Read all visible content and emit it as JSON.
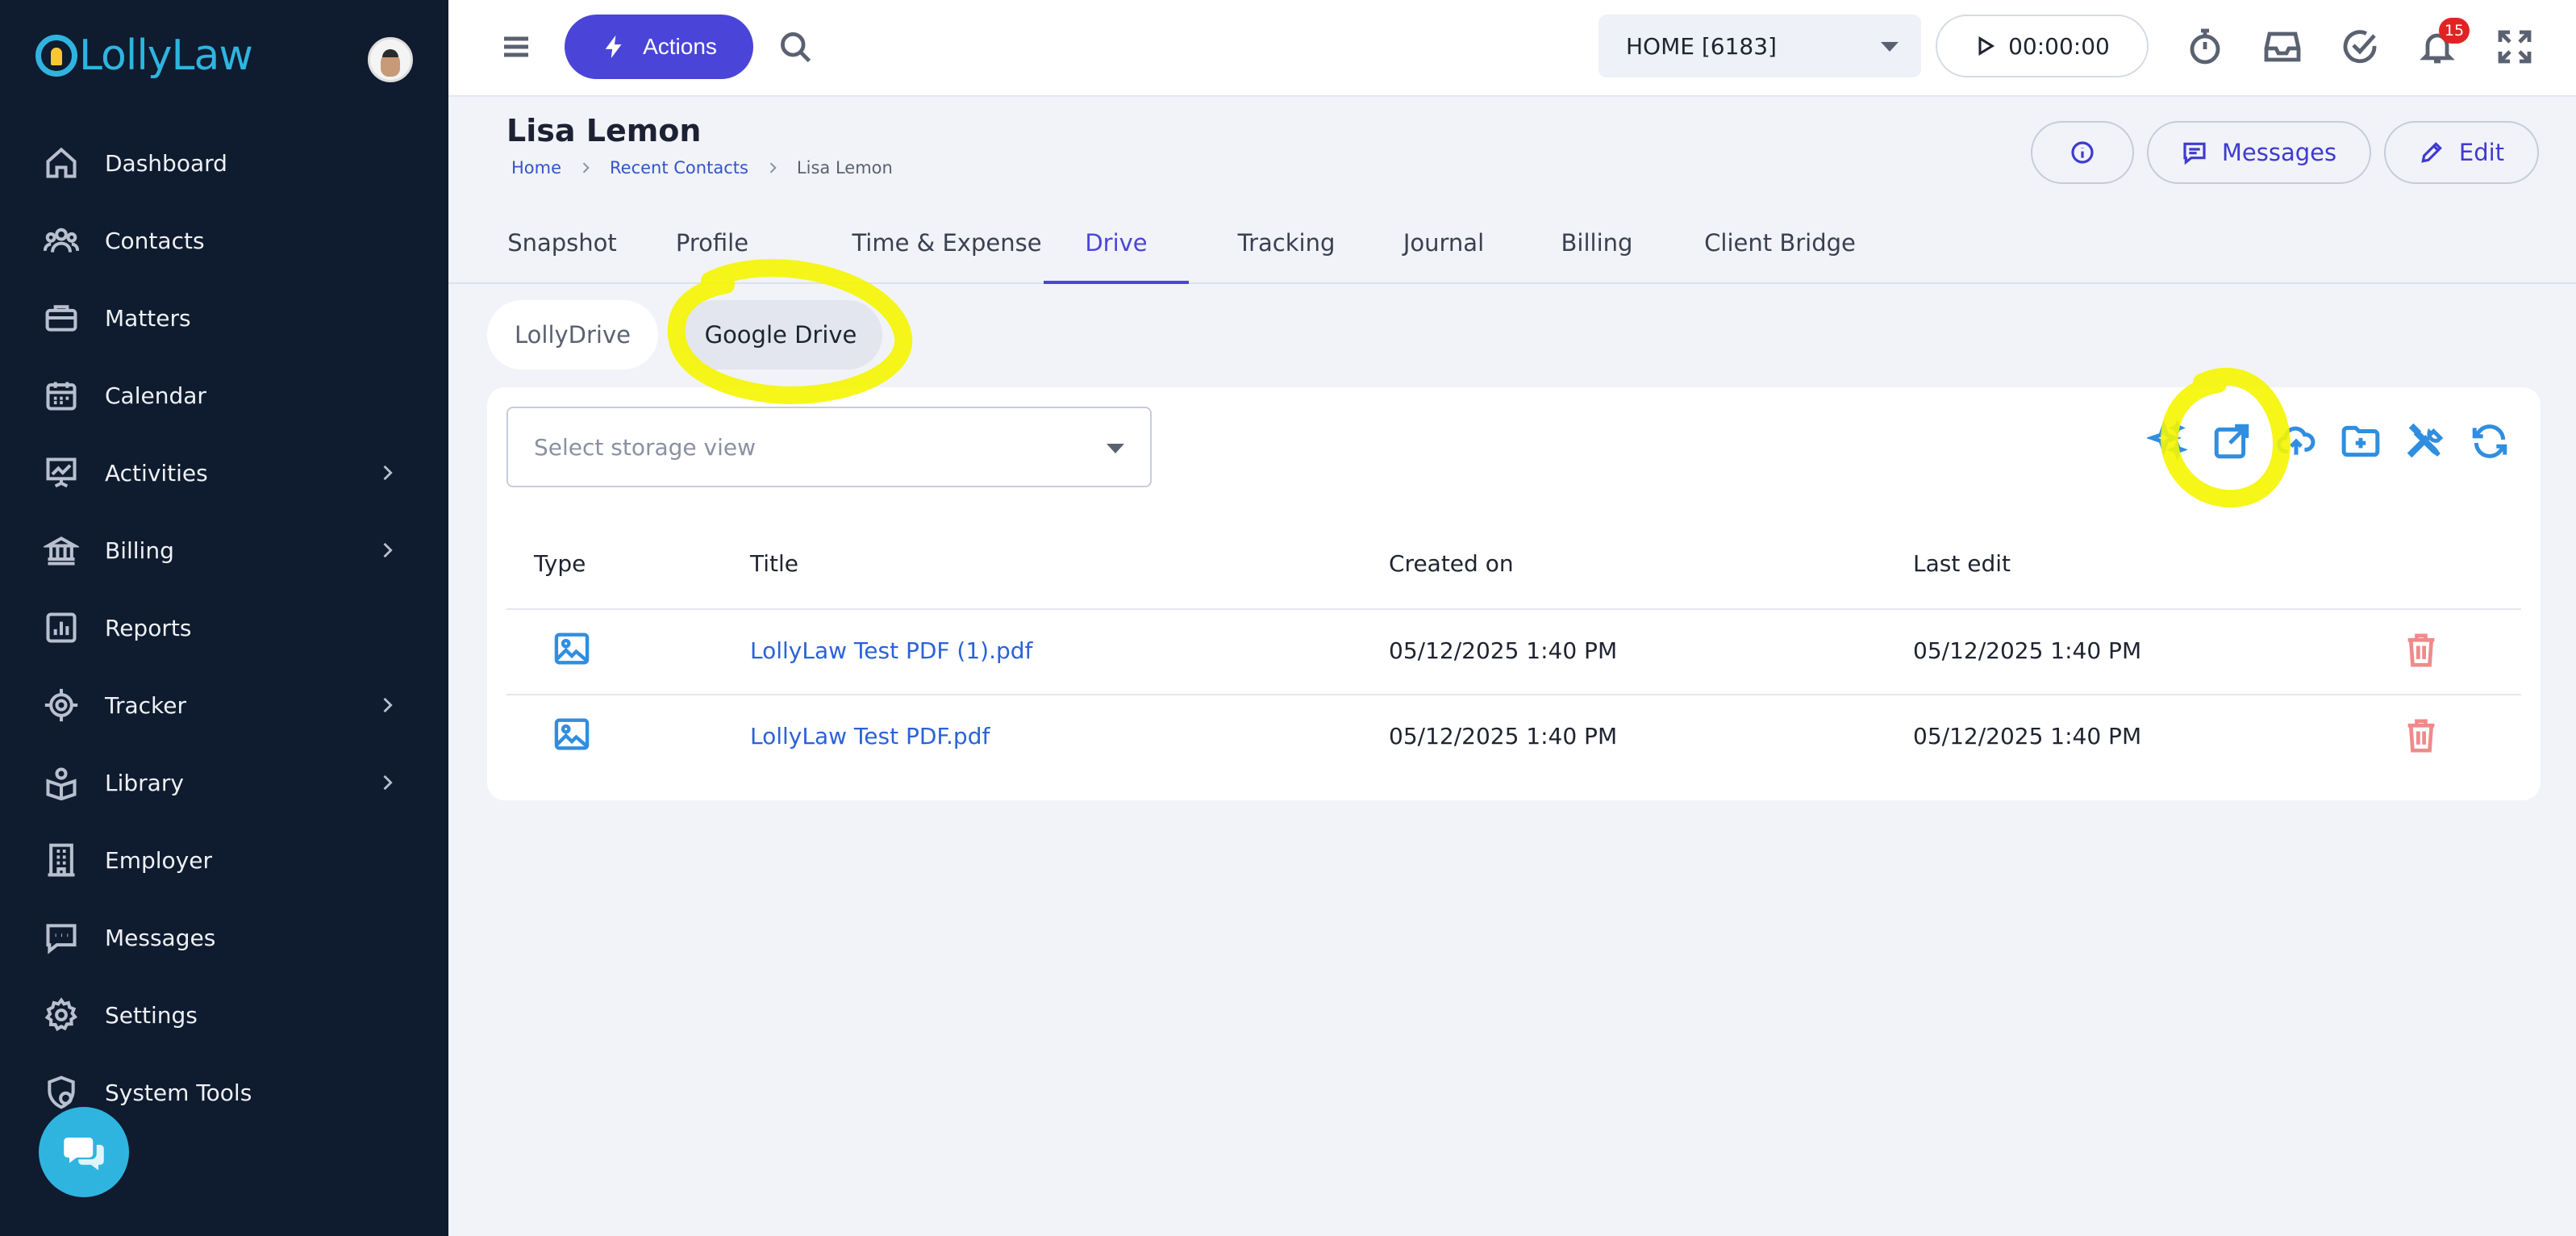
{
  "app": {
    "brand": "LollyLaw"
  },
  "sidebar": {
    "items": [
      {
        "label": "Dashboard",
        "icon": "home-icon",
        "has_submenu": false
      },
      {
        "label": "Contacts",
        "icon": "users-icon",
        "has_submenu": false
      },
      {
        "label": "Matters",
        "icon": "briefcase-icon",
        "has_submenu": false
      },
      {
        "label": "Calendar",
        "icon": "calendar-icon",
        "has_submenu": false
      },
      {
        "label": "Activities",
        "icon": "presentation-chart-icon",
        "has_submenu": true
      },
      {
        "label": "Billing",
        "icon": "bank-icon",
        "has_submenu": true
      },
      {
        "label": "Reports",
        "icon": "bar-chart-icon",
        "has_submenu": false
      },
      {
        "label": "Tracker",
        "icon": "target-icon",
        "has_submenu": true
      },
      {
        "label": "Library",
        "icon": "book-reader-icon",
        "has_submenu": true
      },
      {
        "label": "Employer",
        "icon": "building-icon",
        "has_submenu": false
      },
      {
        "label": "Messages",
        "icon": "chat-bubble-icon",
        "has_submenu": false
      },
      {
        "label": "Settings",
        "icon": "gear-icon",
        "has_submenu": false
      },
      {
        "label": "System Tools",
        "icon": "shield-gear-icon",
        "has_submenu": false
      }
    ]
  },
  "topbar": {
    "actions_label": "Actions",
    "office_select": "HOME [6183]",
    "timer": "00:00:00",
    "notification_count": "15"
  },
  "header": {
    "title": "Lisa Lemon",
    "breadcrumb": [
      "Home",
      "Recent Contacts",
      "Lisa Lemon"
    ],
    "messages_label": "Messages",
    "edit_label": "Edit"
  },
  "tabs": [
    "Snapshot",
    "Profile",
    "Time & Expense",
    "Drive",
    "Tracking",
    "Journal",
    "Billing",
    "Client Bridge"
  ],
  "active_tab": "Drive",
  "drive": {
    "subtabs": [
      "LollyDrive",
      "Google Drive"
    ],
    "active_subtab": "Google Drive",
    "storage_placeholder": "Select storage view",
    "columns": [
      "Type",
      "Title",
      "Created on",
      "Last edit"
    ],
    "files": [
      {
        "title": "LollyLaw Test PDF (1).pdf",
        "created": "05/12/2025 1:40 PM",
        "edited": "05/12/2025 1:40 PM"
      },
      {
        "title": "LollyLaw Test PDF.pdf",
        "created": "05/12/2025 1:40 PM",
        "edited": "05/12/2025 1:40 PM"
      }
    ]
  },
  "colors": {
    "sidebar_bg": "#0f1b2e",
    "accent": "#4a45d8",
    "link": "#2a62d8",
    "tool_icon": "#2f8ee0",
    "highlighter": "#f5f500"
  }
}
